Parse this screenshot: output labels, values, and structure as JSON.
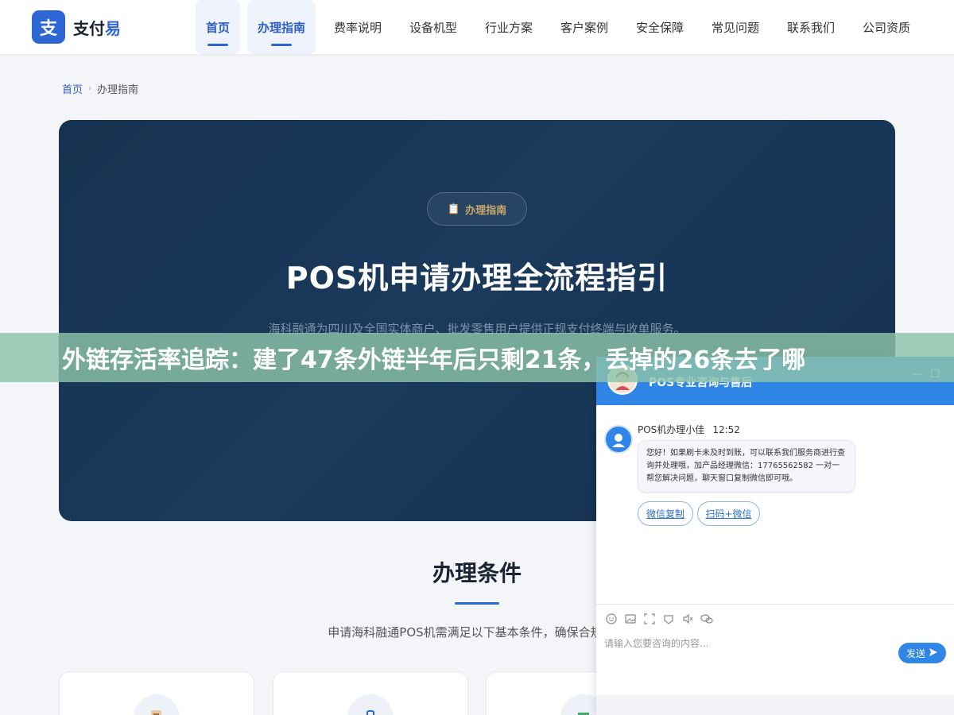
{
  "header": {
    "logo_mark": "支",
    "logo_text_main": "支付",
    "logo_text_accent": "易",
    "nav": [
      {
        "label": "首页",
        "active": true
      },
      {
        "label": "办理指南",
        "active": true
      },
      {
        "label": "费率说明",
        "active": false
      },
      {
        "label": "设备机型",
        "active": false
      },
      {
        "label": "行业方案",
        "active": false
      },
      {
        "label": "客户案例",
        "active": false
      },
      {
        "label": "安全保障",
        "active": false
      },
      {
        "label": "常见问题",
        "active": false
      },
      {
        "label": "联系我们",
        "active": false
      },
      {
        "label": "公司资质",
        "active": false
      }
    ]
  },
  "breadcrumb": {
    "home": "首页",
    "separator": "›",
    "current": "办理指南"
  },
  "hero": {
    "badge_icon": "📋",
    "badge": "办理指南",
    "title": "POS机申请办理全流程指引",
    "description": "海科融通为四川及全国实体商户、批发零售用户提供正规支付终端与收单服务。"
  },
  "banner": {
    "text": "外链存活率追踪：建了47条外链半年后只剩21条，丢掉的26条去了哪"
  },
  "conditions": {
    "title": "办理条件",
    "subtitle": "申请海科融通POS机需满足以下基本条件，确保合规经营"
  },
  "chat": {
    "title": "POS专业咨询与售后",
    "minimize": "—",
    "maximize": "☐",
    "agent_name": "POS机办理小佳",
    "time": "12:52",
    "message": "您好！如果刷卡未及时到账，可以联系我们服务商进行查询并处理哦，加产品经理微信：17765562582 一对一帮您解决问题，聊天窗口复制微信即可哦。",
    "quick_replies": [
      "微信复制",
      "扫码+微信"
    ],
    "input_placeholder": "请输入您要咨询的内容...",
    "send_label": "发送"
  },
  "colors": {
    "brand": "#2f66d6",
    "hero_bg": "#16324f",
    "banner_bg": "#8cc3aa",
    "chat_header": "#2f86e6"
  }
}
